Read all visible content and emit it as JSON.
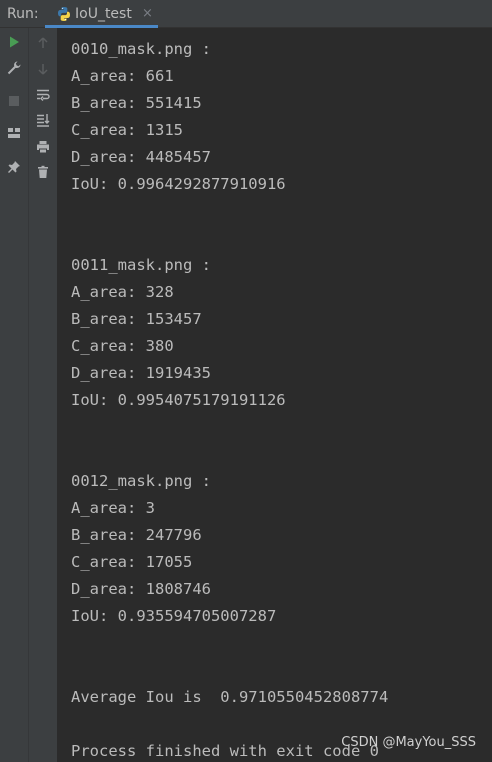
{
  "header": {
    "run_label": "Run:",
    "tab_label": "IoU_test",
    "close_glyph": "×"
  },
  "toolbar": {
    "left": [
      {
        "name": "run-icon",
        "color": "#499c54"
      },
      {
        "name": "wrench-icon",
        "color": "#afb1b3"
      },
      {
        "name": "stop-icon",
        "color": "#5a5d5f"
      },
      {
        "name": "layout-icon",
        "color": "#afb1b3"
      },
      {
        "name": "pin-icon",
        "color": "#afb1b3"
      }
    ],
    "right": [
      {
        "name": "arrow-up-icon",
        "color": "#5a5d5f"
      },
      {
        "name": "arrow-down-icon",
        "color": "#5a5d5f"
      },
      {
        "name": "soft-wrap-icon",
        "color": "#afb1b3"
      },
      {
        "name": "scroll-to-end-icon",
        "color": "#afb1b3"
      },
      {
        "name": "print-icon",
        "color": "#afb1b3"
      },
      {
        "name": "trash-icon",
        "color": "#afb1b3"
      }
    ]
  },
  "console": {
    "lines": [
      "0010_mask.png :",
      "A_area: 661",
      "B_area: 551415",
      "C_area: 1315",
      "D_area: 4485457",
      "IoU: 0.9964292877910916",
      "",
      "",
      "0011_mask.png :",
      "A_area: 328",
      "B_area: 153457",
      "C_area: 380",
      "D_area: 1919435",
      "IoU: 0.9954075179191126",
      "",
      "",
      "0012_mask.png :",
      "A_area: 3",
      "B_area: 247796",
      "C_area: 17055",
      "D_area: 1808746",
      "IoU: 0.935594705007287",
      "",
      "",
      "Average Iou is  0.9710550452808774",
      "",
      "Process finished with exit code 0"
    ]
  },
  "watermark": "CSDN @MayYou_SSS",
  "colors": {
    "background": "#2b2b2b",
    "toolbar": "#3c3f41",
    "text": "#bbbbbb",
    "tab_underline": "#4a88c7"
  }
}
